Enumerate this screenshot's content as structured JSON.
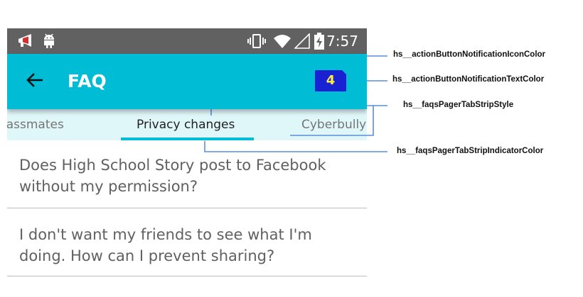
{
  "status_bar": {
    "time": "7:57",
    "icons": [
      "megaphone-icon",
      "android-icon",
      "vibrate-icon",
      "wifi-icon",
      "signal-icon",
      "battery-charging-icon"
    ]
  },
  "action_bar": {
    "title": "FAQ",
    "back_icon": "arrow-back-icon",
    "notification_count": "4"
  },
  "tabs": [
    {
      "label": "lassmates",
      "selected": false
    },
    {
      "label": "Privacy changes",
      "selected": true
    },
    {
      "label": "Cyberbully",
      "selected": false
    }
  ],
  "faq_items": [
    {
      "lines": [
        "Does High School Story post to Facebook",
        "without my permission?"
      ]
    },
    {
      "lines": [
        "I don't want my friends to see what I'm",
        "doing. How can I prevent sharing?"
      ]
    }
  ],
  "annotations": [
    "hs__actionButtonNotificationIconColor",
    "hs__actionButtonNotificationTextColor",
    "hs__faqsPagerTabStripStyle",
    "hs__faqsPagerTabStripIndicatorColor"
  ],
  "colors": {
    "status_bar": "#616161",
    "action_bar": "#00BCD4",
    "tab_strip": "#E0F7FA",
    "badge_bg": "#1A21D2",
    "badge_text": "#FFEB3B",
    "annotation_line": "#5B8EDC"
  }
}
